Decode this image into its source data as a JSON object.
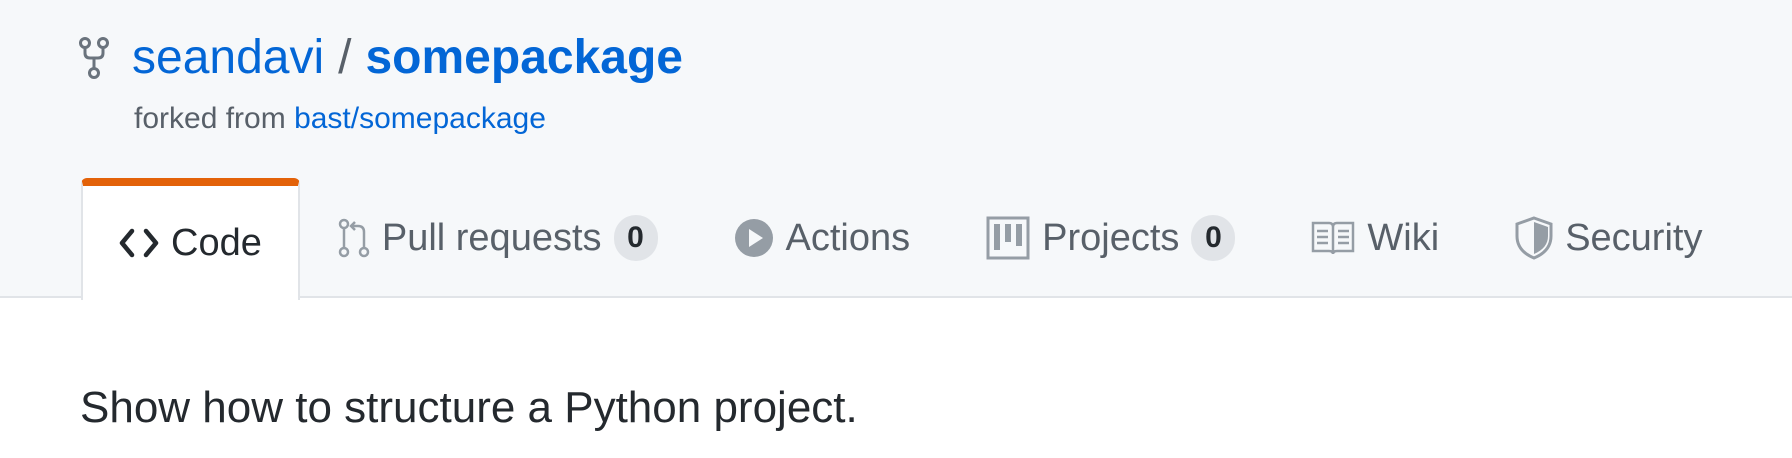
{
  "repo": {
    "owner": "seandavi",
    "separator": "/",
    "name": "somepackage",
    "fork_prefix": "forked from",
    "fork_source": "bast/somepackage"
  },
  "tabs": [
    {
      "label": "Code",
      "icon": "code-icon",
      "selected": true
    },
    {
      "label": "Pull requests",
      "icon": "pull-request-icon",
      "counter": "0"
    },
    {
      "label": "Actions",
      "icon": "play-icon"
    },
    {
      "label": "Projects",
      "icon": "project-icon",
      "counter": "0"
    },
    {
      "label": "Wiki",
      "icon": "book-icon"
    },
    {
      "label": "Security",
      "icon": "shield-icon"
    }
  ],
  "description": "Show how to structure a Python project.",
  "colors": {
    "link": "#0366d6",
    "accent_tab": "#e36209",
    "muted": "#586069",
    "text": "#24292e",
    "header_bg": "#f6f8fa"
  }
}
